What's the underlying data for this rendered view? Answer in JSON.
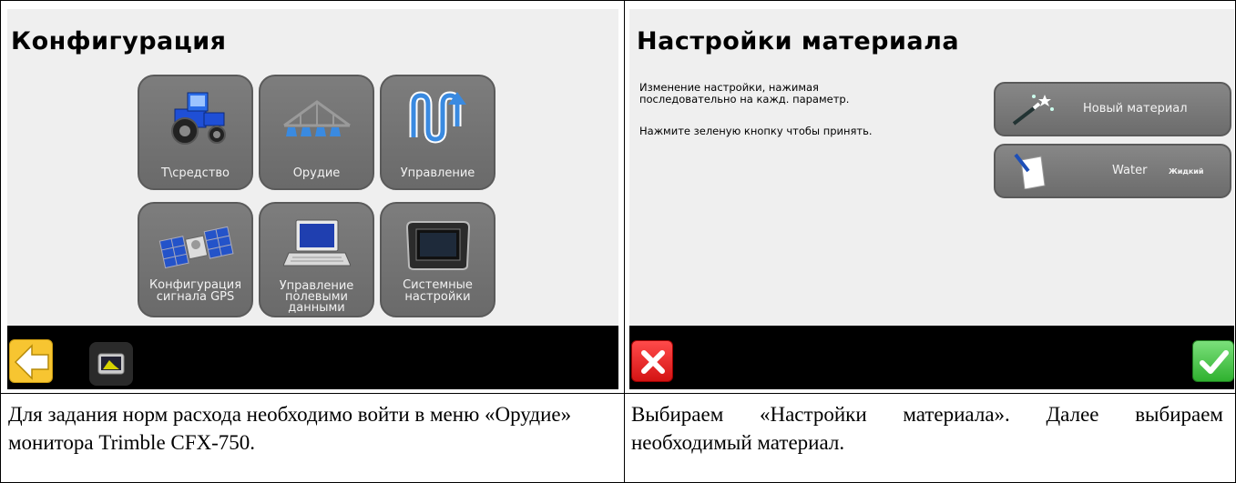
{
  "left_screen": {
    "title": "Конфигурация",
    "tiles": [
      {
        "label": "Т\\средство",
        "icon": "tractor-icon"
      },
      {
        "label": "Орудие",
        "icon": "boom-sprayer-icon"
      },
      {
        "label": "Управление",
        "icon": "guidance-pattern-icon"
      },
      {
        "label": "Конфигурация сигнала GPS",
        "icon": "satellite-icon"
      },
      {
        "label": "Управление полевыми данными",
        "icon": "laptop-icon"
      },
      {
        "label": "Системные настройки",
        "icon": "display-monitor-icon"
      }
    ],
    "bottom_bar": {
      "back_icon": "arrow-left-icon",
      "home_icon": "monitor-home-icon"
    }
  },
  "right_screen": {
    "title": "Настройки материала",
    "instruction_1": "Изменение настройки, нажимая последовательно на кажд. параметр.",
    "instruction_2": "Нажмите зеленую кнопку чтобы принять.",
    "new_material_label": "Новый материал",
    "material": {
      "name": "Water",
      "type": "Жидкий"
    },
    "bottom_bar": {
      "cancel_icon": "close-x-icon",
      "accept_icon": "checkmark-icon"
    }
  },
  "captions": {
    "left": "Для задания норм расхода необходимо войти в меню «Орудие» монитора Trimble CFX-750.",
    "right": "Выбираем «Настройки материала». Далее выбираем необходимый материал."
  },
  "colors": {
    "screen_bg": "#efefef",
    "tile_bg": "#737373",
    "back_button": "#f7c531",
    "cancel": "#e02020",
    "accept": "#3cbe3c"
  }
}
